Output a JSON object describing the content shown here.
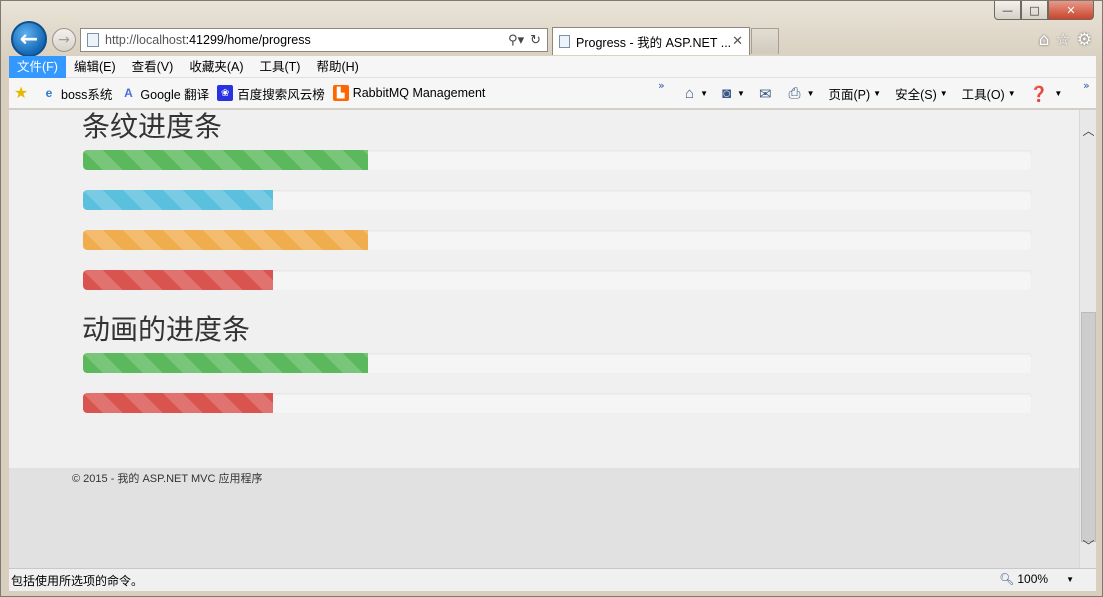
{
  "browser": {
    "url_host": "http://localhost",
    "url_path": ":41299/home/progress",
    "tab_title": "Progress - 我的 ASP.NET ..."
  },
  "menu": [
    "文件(F)",
    "编辑(E)",
    "查看(V)",
    "收藏夹(A)",
    "工具(T)",
    "帮助(H)"
  ],
  "favorites": [
    "boss系统",
    "Google 翻译",
    "百度搜索风云榜",
    "RabbitMQ Management"
  ],
  "commands": {
    "page": "页面(P)",
    "safety": "安全(S)",
    "tools": "工具(O)"
  },
  "sections": [
    {
      "title": "条纹进度条",
      "bars": [
        {
          "percent": 30,
          "color": "#5cb85c"
        },
        {
          "percent": 20,
          "color": "#5bc0de"
        },
        {
          "percent": 30,
          "color": "#f0ad4e"
        },
        {
          "percent": 20,
          "color": "#d9534f"
        }
      ]
    },
    {
      "title": "动画的进度条",
      "bars": [
        {
          "percent": 30,
          "color": "#5cb85c"
        },
        {
          "percent": 20,
          "color": "#d9534f"
        }
      ]
    }
  ],
  "footer": "© 2015 - 我的 ASP.NET MVC 应用程序",
  "status": {
    "text": "包括使用所选项的命令。",
    "zoom": "100%"
  }
}
